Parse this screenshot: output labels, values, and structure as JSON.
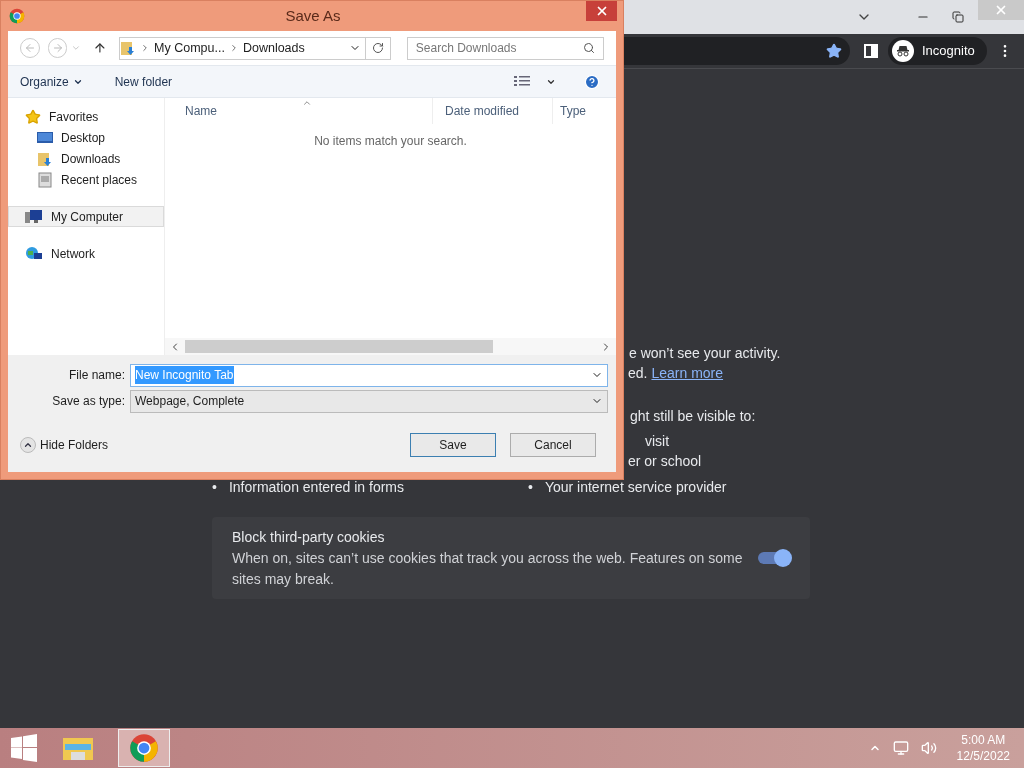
{
  "browser": {
    "profile_label": "Incognito",
    "bookmarked": true,
    "fragments": [
      {
        "text": "e won’t see your activity."
      },
      {
        "text": "ed.",
        "link": "Learn more"
      },
      {
        "text": "ght still be visible to:"
      },
      {
        "text": "visit"
      },
      {
        "text": "er or school"
      }
    ],
    "bullets": [
      {
        "marker": "•",
        "text": "Information entered in forms"
      },
      {
        "marker": "•",
        "text": "Your internet service provider"
      }
    ],
    "cookie_card": {
      "title": "Block third-party cookies",
      "description": "When on, sites can’t use cookies that track you across the web. Features on some sites may break.",
      "on": true
    }
  },
  "dialog": {
    "title": "Save As",
    "breadcrumb": [
      "My Compu...",
      "Downloads"
    ],
    "search": {
      "placeholder": "Search Downloads"
    },
    "toolbar": [
      "Organize",
      "New folder"
    ],
    "nav": [
      {
        "label": "Favorites",
        "kind": "star",
        "selected": false,
        "children": [
          {
            "label": "Desktop",
            "kind": "desktop",
            "selected": false
          },
          {
            "label": "Downloads",
            "kind": "downloads",
            "selected": false
          },
          {
            "label": "Recent places",
            "kind": "recent",
            "selected": false
          }
        ]
      },
      {
        "label": "My Computer",
        "kind": "computer",
        "selected": true
      },
      {
        "label": "Network",
        "kind": "network",
        "selected": false
      }
    ],
    "columns": [
      "Name",
      "Date modified",
      "Type"
    ],
    "empty_message": "No items match your search.",
    "file_name": {
      "label": "File name:",
      "value": "New Incognito Tab",
      "selected": true
    },
    "save_type": {
      "label": "Save as type:",
      "value": "Webpage, Complete"
    },
    "hide_folders": "Hide Folders",
    "buttons": [
      {
        "label": "Save",
        "default": true
      },
      {
        "label": "Cancel",
        "default": false
      }
    ]
  },
  "taskbar": {
    "apps": [
      {
        "kind": "explorer",
        "active": false
      },
      {
        "kind": "chrome",
        "active": true
      }
    ],
    "time": "5:00 AM",
    "date": "12/5/2022"
  }
}
